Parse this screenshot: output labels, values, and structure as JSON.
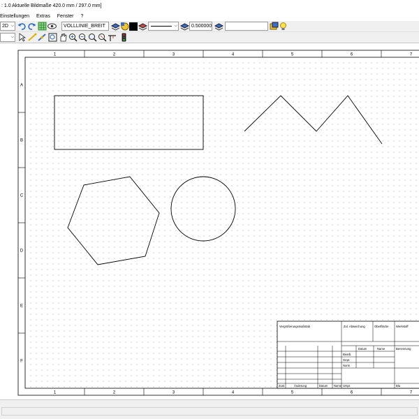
{
  "titlebar": {
    "text": ": 1.0   Aktuelle Bildmaße 420.0 mm / 297.0 mm]"
  },
  "menu": {
    "items": [
      "Einstellungen",
      "Extras",
      "Fenster",
      "?"
    ]
  },
  "toolbar": {
    "view_mode": "2D",
    "layer_name": "VOLLLINIE_BREIT",
    "line_width": "0.500000",
    "search_value": "",
    "left_combo_value": ""
  },
  "drawing": {
    "column_labels": [
      "1",
      "2",
      "3",
      "4",
      "5",
      "6",
      "7"
    ],
    "row_labels": [
      "A",
      "B",
      "C",
      "D",
      "E",
      "F"
    ],
    "title_block": {
      "cells": {
        "header_left": "Vergrößerungsmaßstab",
        "header_mid": "Zul. Abweichung",
        "header_surface": "Oberfläche",
        "header_material": "Werkstoff",
        "col_datum": "Datum",
        "col_name": "Name",
        "col_benennung": "Benennung",
        "row_bearb": "Bearb.",
        "row_gepr": "Gepr.",
        "row_norm": "Norm",
        "foot_zust": "Zust.",
        "foot_aenderung": "Änderung",
        "foot_datum": "Datum",
        "foot_name": "Name",
        "foot_urspr": "Urspr.",
        "foot_blatt": "Bla"
      }
    }
  }
}
